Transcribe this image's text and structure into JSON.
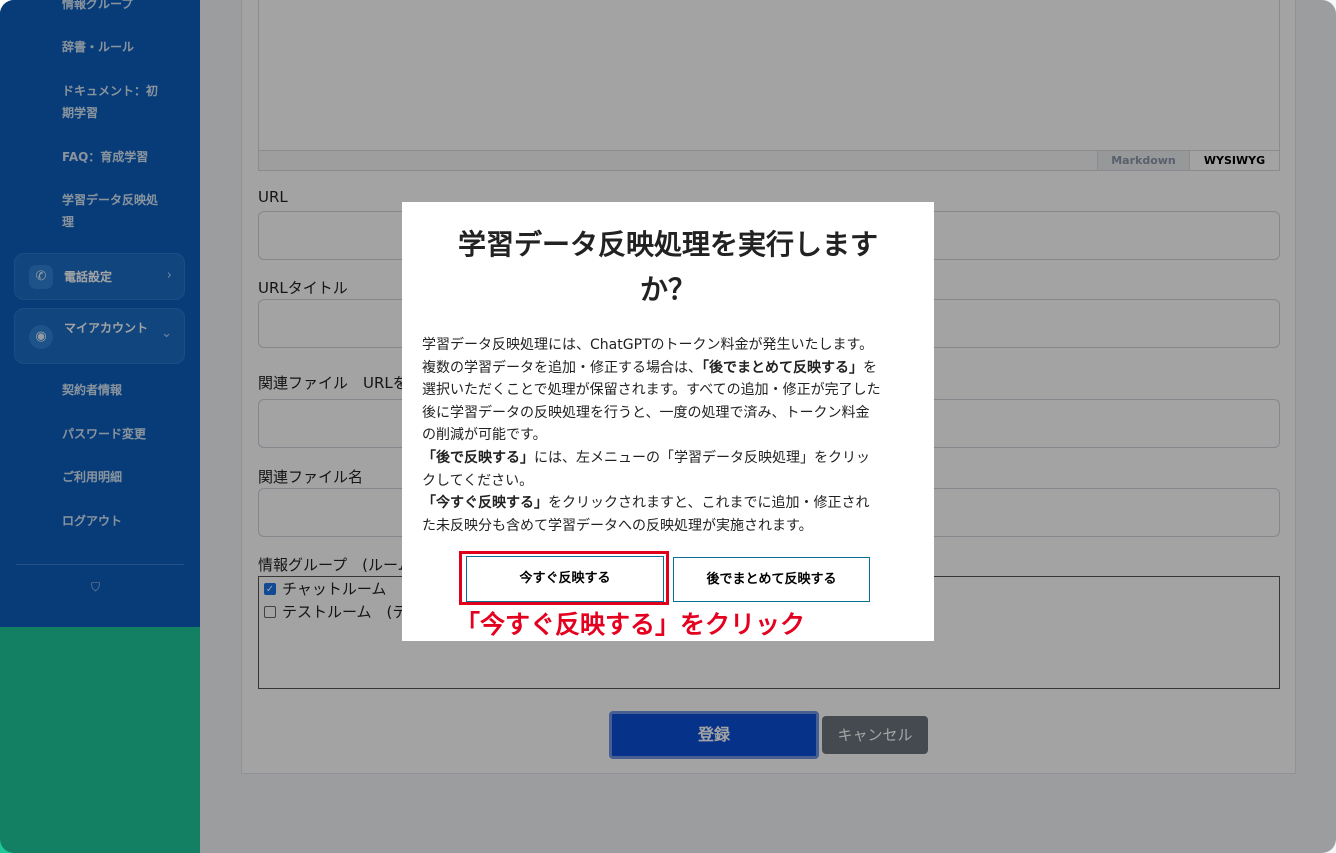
{
  "sidebar": {
    "items": [
      {
        "label": "情報グループ"
      },
      {
        "label": "辞書・ルール"
      },
      {
        "label": "ドキュメント：初期学習"
      },
      {
        "label": "FAQ：育成学習"
      },
      {
        "label": "学習データ反映処理"
      }
    ],
    "phone_group": {
      "label": "電話設定",
      "icon": "phone-icon",
      "chevron": "›"
    },
    "account_group": {
      "label": "マイアカウント",
      "icon": "user-circle-icon",
      "chevron": "⌄"
    },
    "account_items": [
      {
        "label": "契約者情報"
      },
      {
        "label": "パスワード変更"
      },
      {
        "label": "ご利用明細"
      },
      {
        "label": "ログアウト"
      }
    ],
    "footer_icon": "shield-icon"
  },
  "form": {
    "editor_tabs": {
      "markdown": "Markdown",
      "wysiwyg": "WYSIWYG"
    },
    "url_label": "URL",
    "url_title_label": "URLタイトル",
    "related_file_label": "関連ファイル　URLを",
    "related_file_name_label": "関連ファイル名",
    "group_label": "情報グループ　(ルーム",
    "groups": [
      {
        "label": "チャットルーム",
        "checked": true
      },
      {
        "label": "テストルーム　(テ",
        "checked": false
      }
    ],
    "submit_label": "登録",
    "cancel_label": "キャンセル"
  },
  "modal": {
    "title": "学習データ反映処理を実行しますか？",
    "body": {
      "line1": "学習データ反映処理には、ChatGPTのトークン料金が発生いたします。",
      "line2_pre": "複数の学習データを追加・修正する場合は、",
      "line2_bold": "「後でまとめて反映する」",
      "line2_post": "を",
      "line3": "選択いただくことで処理が保留されます。すべての追加・修正が完了した",
      "line4": "後に学習データの反映処理を行うと、一度の処理で済み、トークン料金",
      "line5": "の削減が可能です。",
      "line6_bold": "「後で反映する」",
      "line6_post": "には、左メニューの「学習データ反映処理」をクリッ",
      "line7": "クしてください。",
      "line8_bold": "「今すぐ反映する」",
      "line8_post": "をクリックされますと、これまでに追加・修正され",
      "line9": "た未反映分も含めて学習データへの反映処理が実施されます。"
    },
    "now_button": "今すぐ反映する",
    "later_button": "後でまとめて反映する"
  },
  "annotation": {
    "callout": "「今すぐ反映する」をクリック",
    "color": "#e0001a"
  }
}
